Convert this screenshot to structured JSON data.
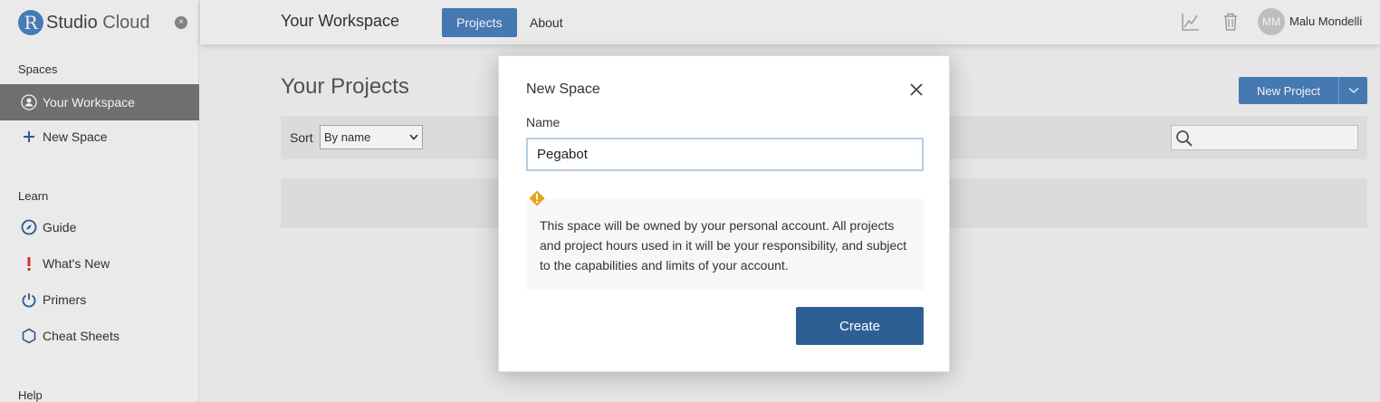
{
  "brand": {
    "logo_letter": "R",
    "name_bold": "Studio",
    "name_light": " Cloud"
  },
  "sidebar": {
    "close_glyph": "×",
    "spaces_heading": "Spaces",
    "items": [
      {
        "label": "Your Workspace",
        "icon": "person-icon"
      },
      {
        "label": "New Space",
        "icon": "plus-icon"
      }
    ],
    "learn_heading": "Learn",
    "learn_items": [
      {
        "label": "Guide",
        "icon": "compass-icon"
      },
      {
        "label": "What's New",
        "icon": "exclamation-icon"
      },
      {
        "label": "Primers",
        "icon": "power-icon"
      },
      {
        "label": "Cheat Sheets",
        "icon": "hexagon-icon"
      }
    ],
    "help_heading": "Help"
  },
  "header": {
    "title": "Your Workspace",
    "tabs": [
      {
        "label": "Projects",
        "active": true
      },
      {
        "label": "About",
        "active": false
      }
    ],
    "user": {
      "initials": "MM",
      "name": "Malu Mondelli"
    }
  },
  "main": {
    "title": "Your Projects",
    "new_project_label": "New Project",
    "sort_label": "Sort",
    "sort_value": "By name",
    "search_placeholder": ""
  },
  "modal": {
    "title": "New Space",
    "name_label": "Name",
    "name_value": "Pegabot",
    "warning_text": "This space will be owned by your personal account. All projects and project hours used in it will be your responsibility, and subject to the capabilities and limits of your account.",
    "create_label": "Create"
  },
  "colors": {
    "accent": "#4a7fbc",
    "create": "#2d5f94",
    "active_sidebar": "#757575",
    "warning": "#e8a317",
    "exclamation": "#d9342b"
  }
}
